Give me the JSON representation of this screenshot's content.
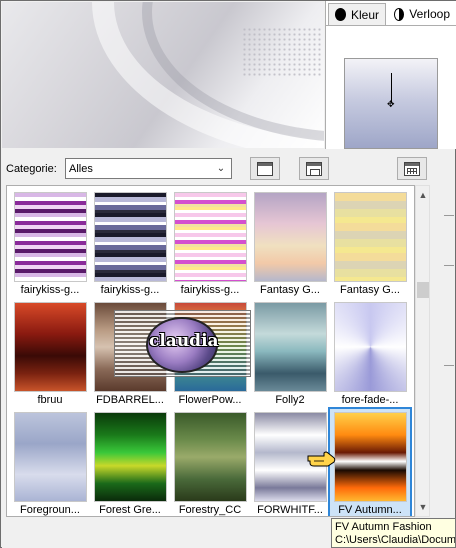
{
  "right_panel": {
    "tab_kleur": "Kleur",
    "tab_verloop": "Verloop"
  },
  "dialog": {
    "category_label": "Categorie:",
    "category_value": "Alles"
  },
  "gradients": [
    {
      "label": "fairykiss-g...",
      "bg": "repeating-linear-gradient(180deg,#d8b7e6 0 4px,#ffffff 4px 8px,#8a2a9a 8px 12px,#f0d6f4 12px 16px,#5a1a6a 16px 20px)"
    },
    {
      "label": "fairykiss-g...",
      "bg": "repeating-linear-gradient(180deg,#1a1a2a 0 4px,#b9b9d8 4px 9px,#ffffff 9px 12px,#6a6a9a 12px 17px,#2a2a3a 17px 20px)"
    },
    {
      "label": "fairykiss-g...",
      "bg": "repeating-linear-gradient(180deg,#f7c8ea 0 4px,#ffffff 4px 7px,#d44fcf 7px 11px,#f2e1a0 11px 14px,#ffe88a 14px 17px,#ffffff 17px 20px)"
    },
    {
      "label": "Fantasy G...",
      "bg": "linear-gradient(180deg,#b4a4c4 0%,#e6c6d4 35%,#f0e0c0 60%,#f2c9a8 80%,#b5b8cc 100%)"
    },
    {
      "label": "Fantasy G...",
      "bg": "repeating-linear-gradient(180deg,#f4dc9a 0 8px,#dcd4b4 8px 16px,#e8e0a0 16px 24px,#f5e890 24px 30px)"
    },
    {
      "label": "fbruu",
      "bg": "linear-gradient(180deg,#d84a28 0%,#8a1a10 35%,#3a0a06 60%,#7a2210 80%,#c8542a 100%)"
    },
    {
      "label": "FDBARREL...",
      "bg": "linear-gradient(180deg,#6a4a3a 0%,#b89a82 30%,#d6c2b0 50%,#8a6a58 75%,#5a3a2c 100%)"
    },
    {
      "label": "FlowerPow...",
      "bg": "linear-gradient(180deg,#c8483a 0%,#e8a848 25%,#88c848 50%,#4a9a8a 70%,#2a6a9a 100%)"
    },
    {
      "label": "Folly2",
      "bg": "linear-gradient(180deg,#7a9aa4 0%,#c4dada 35%,#8ab8be 55%,#3a5a6a 80%,#6a8a98 100%)"
    },
    {
      "label": "fore-fade-...",
      "bg": "conic-gradient(from 0deg at 50% 50%,#c8c8f0,#ffffff,#9a9ad8,#ffffff,#c8c8f0)"
    },
    {
      "label": "Foregroun...",
      "bg": "linear-gradient(180deg,#bcc4dc 0%,#9aa6c8 35%,#d8dcec 70%,#aab4d4 100%)"
    },
    {
      "label": "Forest Gre...",
      "bg": "linear-gradient(180deg,#0a3a0a 0%,#1a7a1a 25%,#3ac83a 45%,#c8d82a 60%,#1a6a1a 80%,#0a2a0a 100%)"
    },
    {
      "label": "Forestry_CC",
      "bg": "linear-gradient(180deg,#3a5a2a 0%,#6a8a4a 30%,#9aaa6a 50%,#4a6a3a 75%,#2a3a1a 100%)"
    },
    {
      "label": "FORWHITF...",
      "bg": "linear-gradient(180deg,#8a8aa4 0%,#ffffff 25%,#b4b8cc 45%,#ffffff 65%,#7a7a9a 85%,#dcdcec 100%)"
    },
    {
      "label": "FV Autumn...",
      "bg": "linear-gradient(180deg,#ffd04a 0%,#ff8a10 25%,#6a1a04 45%,#ffffff 55%,#1a0a02 65%,#ff6a0a 85%,#ffb830 100%)"
    }
  ],
  "tooltip": {
    "line1": "FV Autumn Fashion",
    "line2": "C:\\Users\\Claudia\\Documents"
  },
  "watermark": {
    "text": "claudia"
  }
}
